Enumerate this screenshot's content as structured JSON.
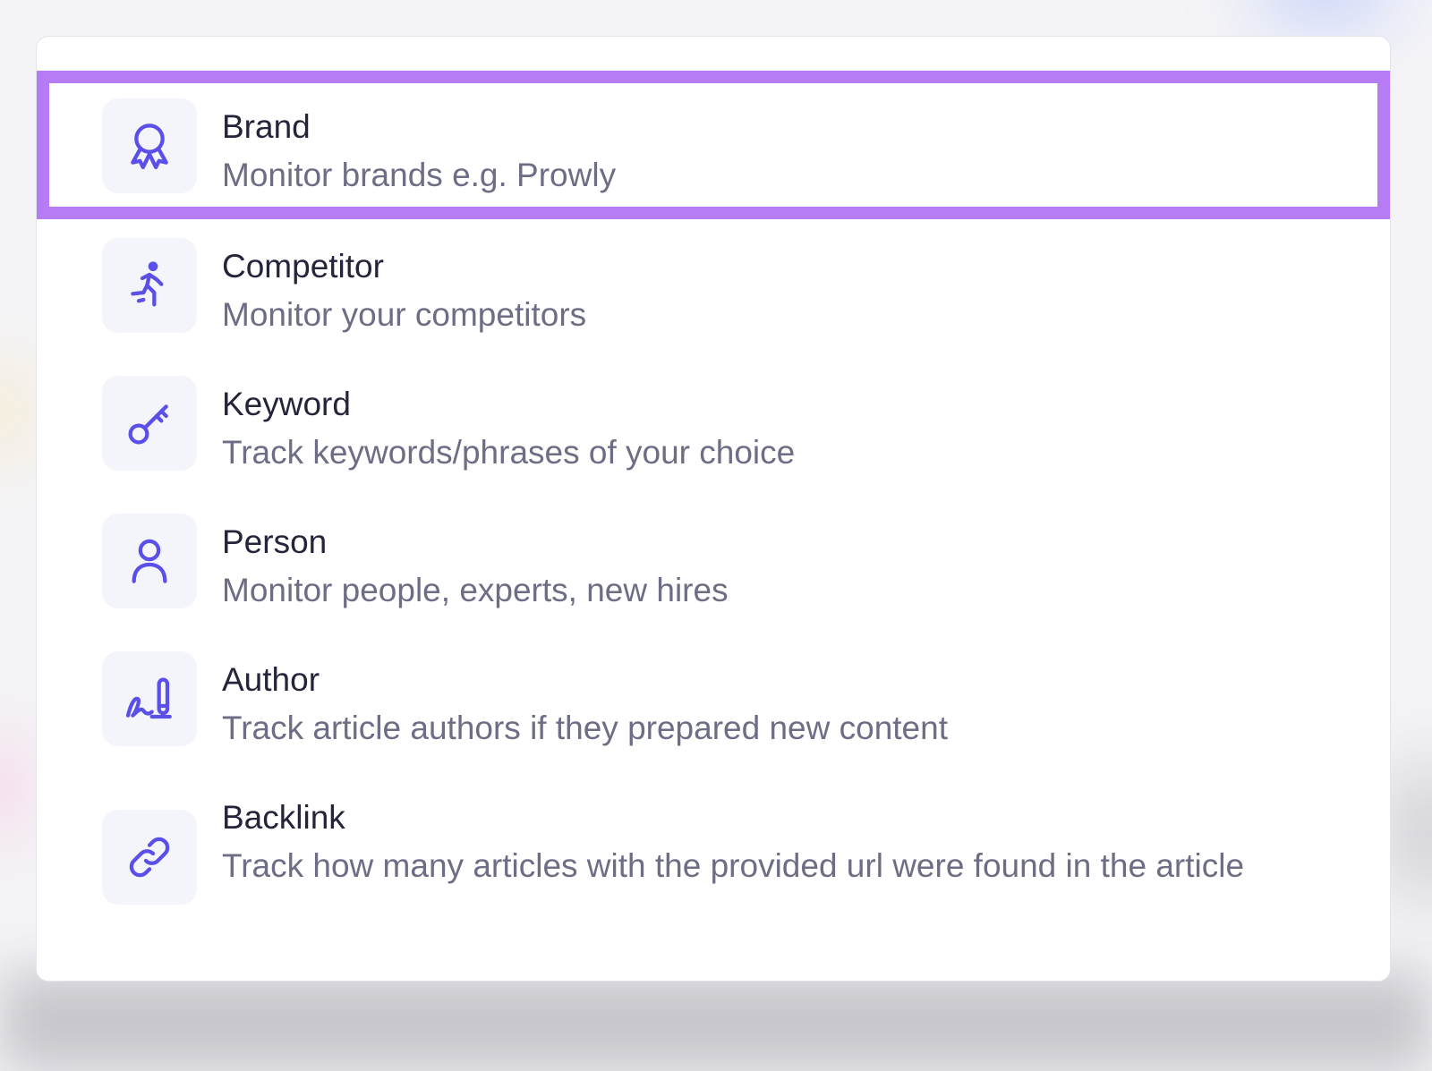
{
  "accent_color": "#5b4fe9",
  "highlight_color": "#b57cf6",
  "options": [
    {
      "title": "Brand",
      "description": "Monitor brands e.g. Prowly",
      "icon": "award-ribbon-icon",
      "selected": true
    },
    {
      "title": "Competitor",
      "description": "Monitor your competitors",
      "icon": "running-person-icon",
      "selected": false
    },
    {
      "title": "Keyword",
      "description": "Track keywords/phrases of your choice",
      "icon": "key-icon",
      "selected": false
    },
    {
      "title": "Person",
      "description": "Monitor people, experts, new hires",
      "icon": "user-icon",
      "selected": false
    },
    {
      "title": "Author",
      "description": "Track article authors if they prepared new content",
      "icon": "signature-pencil-icon",
      "selected": false
    },
    {
      "title": "Backlink",
      "description": "Track how many articles with the provided url were found in the article",
      "icon": "link-icon",
      "selected": false
    }
  ]
}
